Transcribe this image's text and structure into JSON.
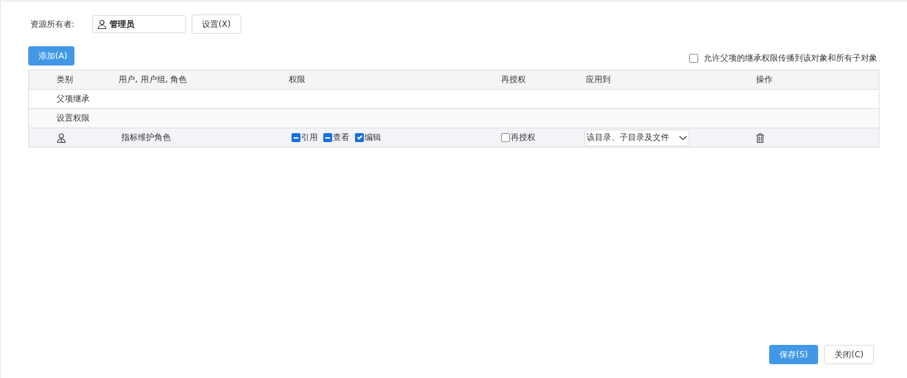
{
  "owner": {
    "label": "资源所有者:",
    "value": "管理员",
    "button": "设置(X)"
  },
  "add_button": "添加(A)",
  "propagate": {
    "label": "允许父项的继承权限传播到该对象和所有子对象",
    "checked": false
  },
  "table": {
    "columns": [
      "类别",
      "用户, 用户组, 角色",
      "权限",
      "再授权",
      "应用到",
      "操作"
    ],
    "sections": [
      "父项继承",
      "设置权限"
    ],
    "rows": [
      {
        "name": "指标维护角色",
        "permissions": [
          {
            "label": "引用",
            "checked": true,
            "indeterminate": true
          },
          {
            "label": "查看",
            "checked": true,
            "indeterminate": true
          },
          {
            "label": "编辑",
            "checked": true,
            "indeterminate": false
          }
        ],
        "regrant": {
          "label": "再授权",
          "checked": false
        },
        "apply_to": "该目录、子目录及文件"
      }
    ]
  },
  "buttons": [
    {
      "label": "保存(S)",
      "primary": true
    },
    {
      "label": "关闭(C)",
      "primary": false
    }
  ]
}
